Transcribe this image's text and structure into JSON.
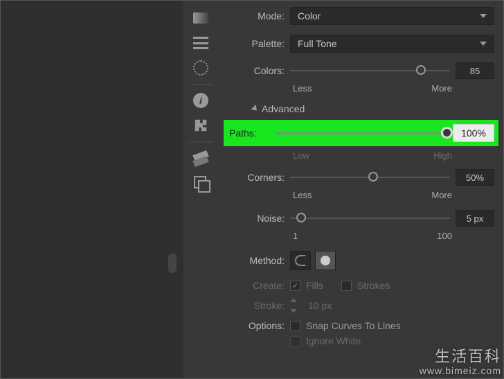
{
  "top": {
    "mode_label": "Mode:",
    "mode_value": "Color",
    "palette_label": "Palette:",
    "palette_value": "Full Tone",
    "colors_label": "Colors:",
    "colors_value": "85",
    "colors_min_text": "Less",
    "colors_max_text": "More",
    "colors_pct": 79
  },
  "advanced": {
    "heading": "Advanced",
    "paths_label": "Paths:",
    "paths_value": "100%",
    "paths_min_text": "Low",
    "paths_max_text": "High",
    "corners_label": "Corners:",
    "corners_value": "50%",
    "corners_min_text": "Less",
    "corners_max_text": "More",
    "corners_pct": 49,
    "noise_label": "Noise:",
    "noise_value": "5 px",
    "noise_min_text": "1",
    "noise_max_text": "100",
    "noise_pct": 4
  },
  "method": {
    "label": "Method:",
    "selected": 1
  },
  "create": {
    "label": "Create:",
    "fills_label": "Fills",
    "fills_checked": true,
    "strokes_label": "Strokes",
    "strokes_checked": false
  },
  "stroke_row": {
    "label": "Stroke:",
    "value": "10 px"
  },
  "options": {
    "label": "Options:",
    "snap_label": "Snap Curves To Lines",
    "snap_checked": false,
    "ignore_label": "Ignore White",
    "ignore_checked": false
  },
  "toolbar": {
    "items": [
      "gradient-icon",
      "lines-icon",
      "dotted-circle-icon",
      "info-icon",
      "puzzle-icon",
      "layers-icon",
      "two-rects-icon"
    ]
  },
  "watermark": {
    "line1": "生活百科",
    "line2": "www.bimeiz.com"
  }
}
